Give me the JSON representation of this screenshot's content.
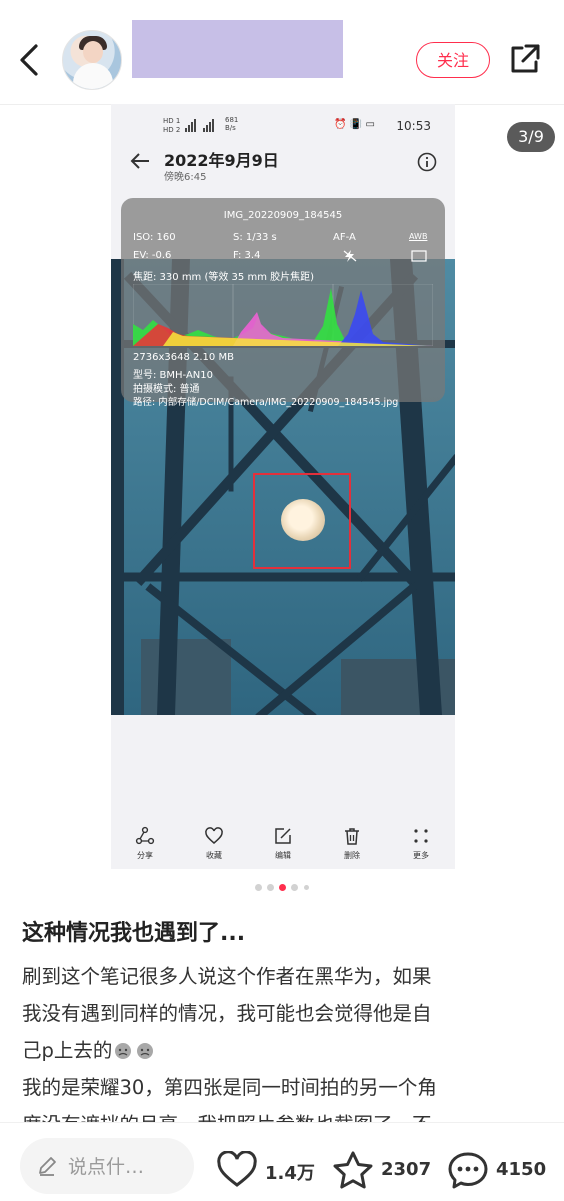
{
  "header": {
    "follow_label": "关注"
  },
  "photo": {
    "page_indicator": "3/9",
    "status": {
      "hd_text": "HD 1\nHD 2",
      "net_speed": "681\nB/s",
      "time": "10:53",
      "sys_icons": "⏰ 📳 ▭"
    },
    "detail": {
      "date": "2022年9月9日",
      "time_of_day": "傍晚6:45"
    },
    "exif": {
      "filename": "IMG_20220909_184545",
      "iso": "ISO: 160",
      "shutter": "S: 1/33 s",
      "af": "AF-A",
      "awb": "AWB",
      "ev": "EV: -0.6",
      "aperture": "F: 3.4",
      "focal": "焦距: 330 mm (等效 35 mm 胶片焦距)",
      "resolution": "2736x3648  2.10 MB",
      "model": "型号:  BMH-AN10",
      "mode": "拍摄模式:  普通",
      "path": "路径:  内部存储/DCIM/Camera/IMG_20220909_184545.jpg"
    },
    "actions": [
      {
        "label": "分享",
        "icon": "share-icon"
      },
      {
        "label": "收藏",
        "icon": "heart-icon"
      },
      {
        "label": "编辑",
        "icon": "edit-icon"
      },
      {
        "label": "删除",
        "icon": "delete-icon"
      },
      {
        "label": "更多",
        "icon": "more-icon"
      }
    ]
  },
  "carousel": {
    "count": 5,
    "active_index": 2
  },
  "post": {
    "title": "这种情况我也遇到了...",
    "line1": "刷到这个笔记很多人说这个作者在黑华为，如果",
    "line2": "我没有遇到同样的情况，我可能也会觉得他是自",
    "line3": "己p上去的",
    "line4": "我的是荣耀30，第四张是同一时间拍的另一个角",
    "line5": "度没有遮挡的月亮，我把照片参数也截图了，不"
  },
  "bottom": {
    "comment_placeholder": "说点什…",
    "likes": "1.4万",
    "favorites": "2307",
    "comments": "4150"
  },
  "colors": {
    "accent": "#ff2e4d",
    "sky": "#3e7a93",
    "name_block": "#c7bfe7"
  }
}
